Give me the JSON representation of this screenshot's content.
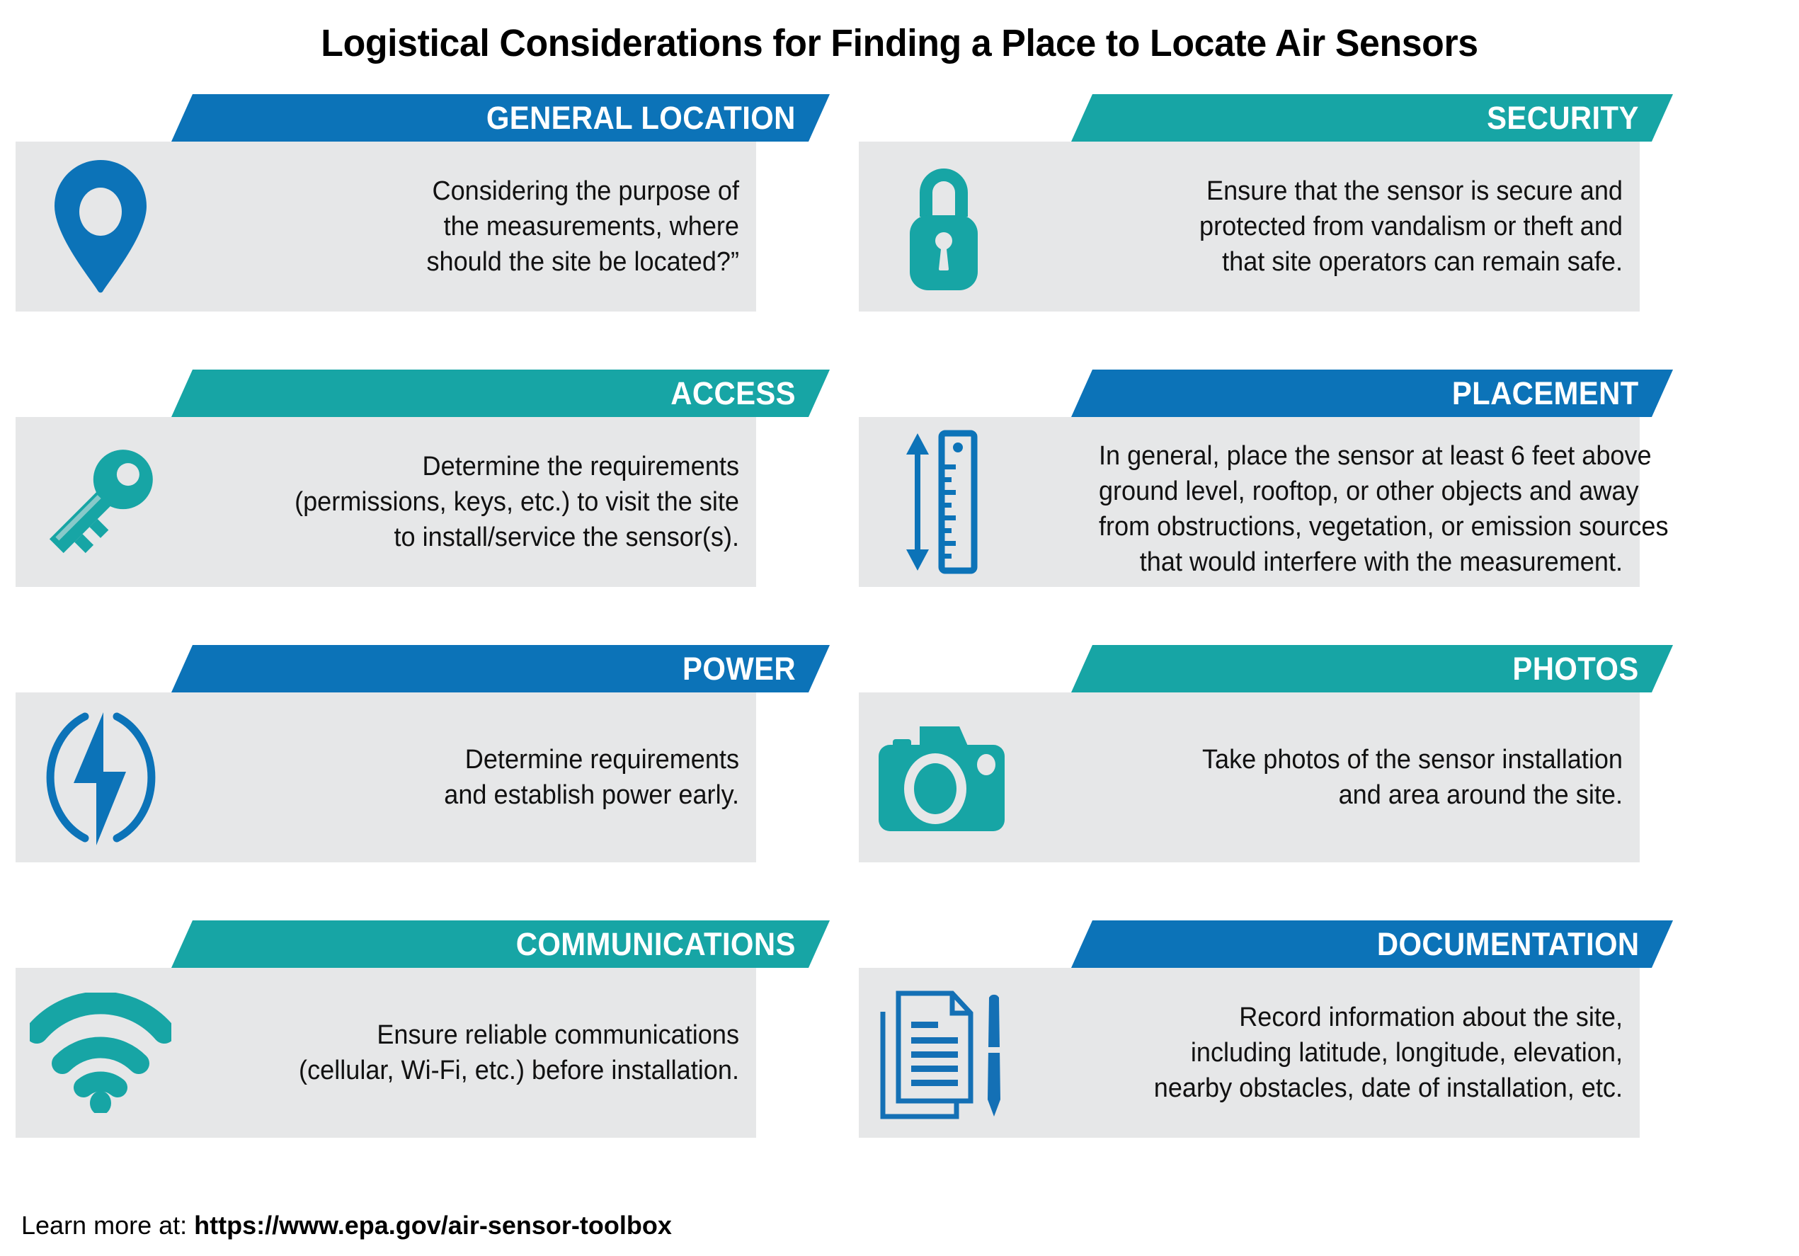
{
  "title": "Logistical Considerations for Finding a Place to Locate Air Sensors",
  "colors": {
    "blue": "#0c73b8",
    "teal": "#17a5a5",
    "panel_gray": "#e6e7e8",
    "text": "#111111",
    "banner_text": "#ffffff"
  },
  "cards": [
    {
      "heading": "GENERAL LOCATION",
      "color": "blue",
      "icon": "map-pin-icon",
      "lines": [
        "Considering the purpose of",
        "the measurements, where",
        "should the site be located?”"
      ]
    },
    {
      "heading": "SECURITY",
      "color": "teal",
      "icon": "lock-icon",
      "lines": [
        "Ensure that the sensor is secure and",
        "protected from vandalism or theft and",
        "that site operators can remain safe."
      ]
    },
    {
      "heading": "ACCESS",
      "color": "teal",
      "icon": "key-icon",
      "lines": [
        "Determine the requirements",
        "(permissions, keys, etc.) to visit the site",
        "to install/service the sensor(s)."
      ]
    },
    {
      "heading": "PLACEMENT",
      "color": "blue",
      "icon": "ruler-icon",
      "lines": [
        "In general, place the sensor at least 6 feet above",
        "ground level, rooftop, or other objects and away",
        "from obstructions, vegetation, or emission sources",
        "that would interfere with the measurement."
      ]
    },
    {
      "heading": "POWER",
      "color": "blue",
      "icon": "lightning-bolt-icon",
      "lines": [
        "Determine requirements",
        "and establish power early."
      ]
    },
    {
      "heading": "PHOTOS",
      "color": "teal",
      "icon": "camera-icon",
      "lines": [
        "Take photos of the sensor installation",
        "and area around the site."
      ]
    },
    {
      "heading": "COMMUNICATIONS",
      "color": "teal",
      "icon": "wifi-icon",
      "lines": [
        "Ensure reliable communications",
        "(cellular, Wi-Fi, etc.) before installation."
      ]
    },
    {
      "heading": "DOCUMENTATION",
      "color": "blue",
      "icon": "document-pen-icon",
      "lines": [
        "Record information about the site,",
        "including latitude, longitude, elevation,",
        "nearby obstacles, date of installation, etc."
      ]
    }
  ],
  "footer": {
    "prefix": "Learn more at: ",
    "url": "https://www.epa.gov/air-sensor-toolbox"
  }
}
